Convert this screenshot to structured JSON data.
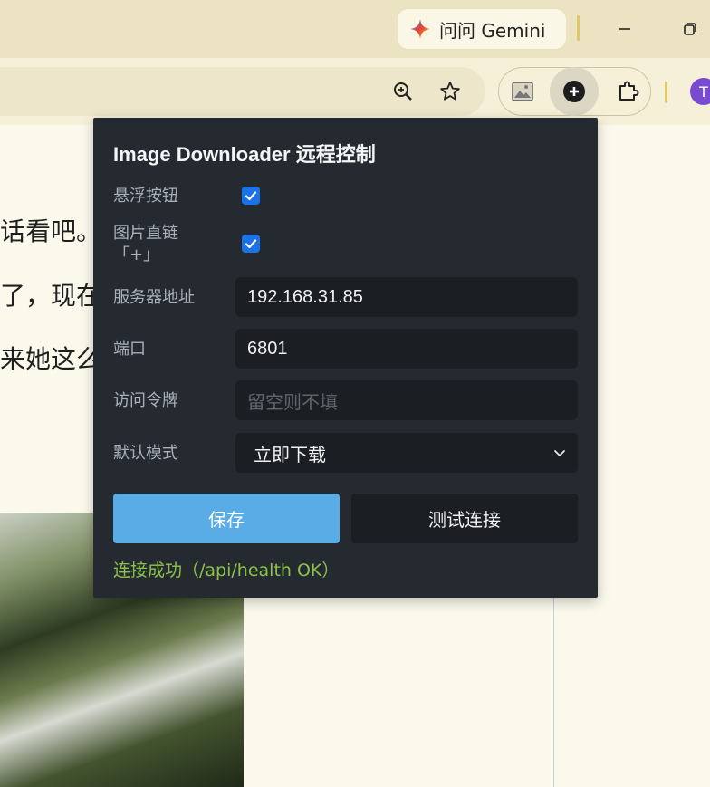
{
  "browser": {
    "gemini_label": "问问 Gemini",
    "avatar_initial": "T",
    "colors": {
      "titlebar": "#ece3c2",
      "toolbar": "#f7f0d8",
      "accent_divider": "#dec86a"
    }
  },
  "article": {
    "lines": [
      "话看吧。",
      "了，现在",
      "来她这么"
    ]
  },
  "popup": {
    "title": "Image Downloader 远程控制",
    "fields": {
      "floating_button": {
        "label": "悬浮按钮",
        "checked": true
      },
      "direct_link": {
        "label_line1": "图片直链",
        "label_line2": "「+」",
        "checked": true
      },
      "server": {
        "label": "服务器地址",
        "value": "192.168.31.85"
      },
      "port": {
        "label": "端口",
        "value": "6801"
      },
      "token": {
        "label": "访问令牌",
        "placeholder": "留空则不填"
      },
      "mode": {
        "label": "默认模式",
        "value": "立即下载"
      }
    },
    "buttons": {
      "save": "保存",
      "test": "测试连接"
    },
    "status": "连接成功（/api/health OK）",
    "colors": {
      "background": "#252a31",
      "save_button": "#5aace6",
      "status_text": "#8bc34a",
      "checkbox": "#1a73e8"
    }
  }
}
